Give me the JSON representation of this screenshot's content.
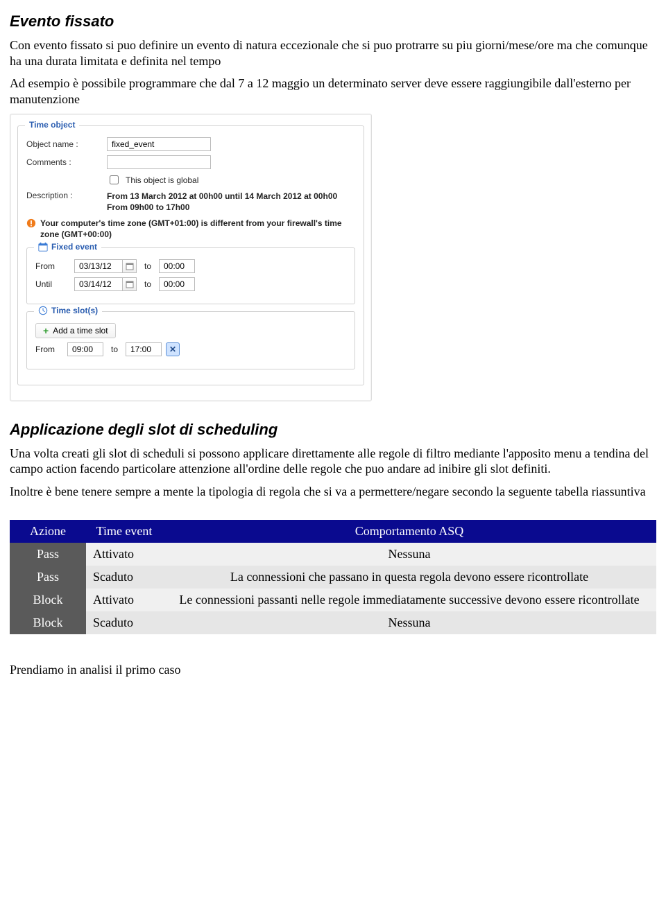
{
  "sections": {
    "s1_title": "Evento fissato",
    "s1_p1": "Con evento fissato si puo definire un evento di natura eccezionale che si puo protrarre su piu giorni/mese/ore ma che comunque ha una durata limitata e definita nel tempo",
    "s1_p2": "Ad esempio è possibile programmare che dal 7 a 12 maggio un determinato server deve essere raggiungibile dall'esterno per manutenzione",
    "s2_title": "Applicazione degli slot di scheduling",
    "s2_p1": "Una volta creati gli slot di scheduli si possono applicare direttamente alle regole di filtro mediante l'apposito menu a tendina del campo action facendo particolare attenzione all'ordine delle regole che puo andare ad inibire gli slot definiti.",
    "s2_p2": "Inoltre è bene tenere sempre a mente la tipologia di regola che si va a permettere/negare secondo la seguente tabella riassuntiva",
    "footer": "Prendiamo in analisi il primo caso"
  },
  "panel": {
    "legend": "Time object",
    "object_name_label": "Object name :",
    "object_name_value": "fixed_event",
    "comments_label": "Comments :",
    "comments_value": "",
    "global_label": "This object is global",
    "description_label": "Description :",
    "description_line1": "From 13 March 2012 at 00h00 until 14 March 2012 at 00h00",
    "description_line2": "From 09h00 to 17h00",
    "warn_text": "Your computer's time zone (GMT+01:00) is different from your firewall's time zone (GMT+00:00)",
    "fixed": {
      "legend": "Fixed event",
      "from_label": "From",
      "from_date": "03/13/12",
      "from_time": "00:00",
      "to_label": "to",
      "until_label": "Until",
      "until_date": "03/14/12",
      "until_time": "00:00"
    },
    "slots": {
      "legend": "Time slot(s)",
      "add_label": "Add a time slot",
      "from_label": "From",
      "from_value": "09:00",
      "to_label": "to",
      "to_value": "17:00"
    }
  },
  "table": {
    "headers": {
      "c1": "Azione",
      "c2": "Time event",
      "c3": "Comportamento ASQ"
    },
    "rows": [
      {
        "c1": "Pass",
        "c2": "Attivato",
        "c3": "Nessuna"
      },
      {
        "c1": "Pass",
        "c2": "Scaduto",
        "c3": "La connessioni che passano in questa regola devono essere ricontrollate"
      },
      {
        "c1": "Block",
        "c2": "Attivato",
        "c3": "Le connessioni passanti nelle regole immediatamente successive devono essere ricontrollate"
      },
      {
        "c1": "Block",
        "c2": "Scaduto",
        "c3": "Nessuna"
      }
    ]
  }
}
